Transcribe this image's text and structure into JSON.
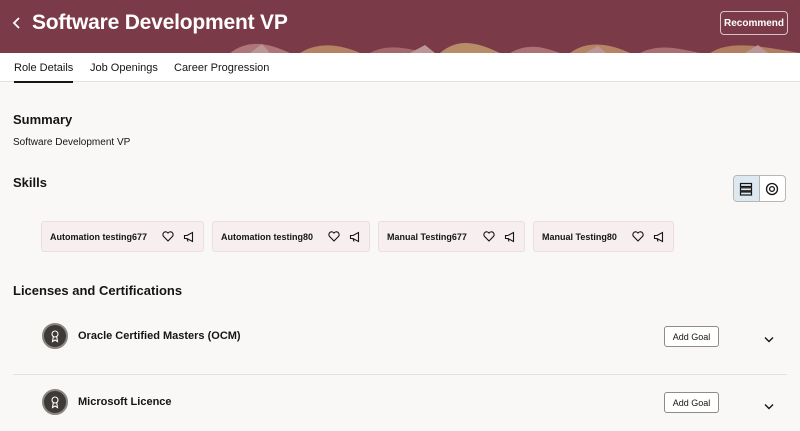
{
  "header": {
    "title": "Software Development VP",
    "recommend_label": "Recommend",
    "background_color": "#7b3a47"
  },
  "tabs": [
    {
      "label": "Role Details",
      "active": true
    },
    {
      "label": "Job Openings",
      "active": false
    },
    {
      "label": "Career Progression",
      "active": false
    }
  ],
  "summary": {
    "heading": "Summary",
    "text": "Software Development VP"
  },
  "skills": {
    "heading": "Skills",
    "view_modes": [
      "list-view-icon",
      "target-view-icon"
    ],
    "selected_view": "list-view-icon",
    "items": [
      {
        "label": "Automation testing677"
      },
      {
        "label": "Automation testing80"
      },
      {
        "label": "Manual Testing677"
      },
      {
        "label": "Manual Testing80"
      }
    ]
  },
  "licenses": {
    "heading": "Licenses and Certifications",
    "items": [
      {
        "title": "Oracle Certified Masters (OCM)",
        "action_label": "Add Goal",
        "icon": "certificate-icon"
      },
      {
        "title": "Microsoft Licence",
        "action_label": "Add Goal",
        "icon": "certificate-icon"
      }
    ]
  }
}
